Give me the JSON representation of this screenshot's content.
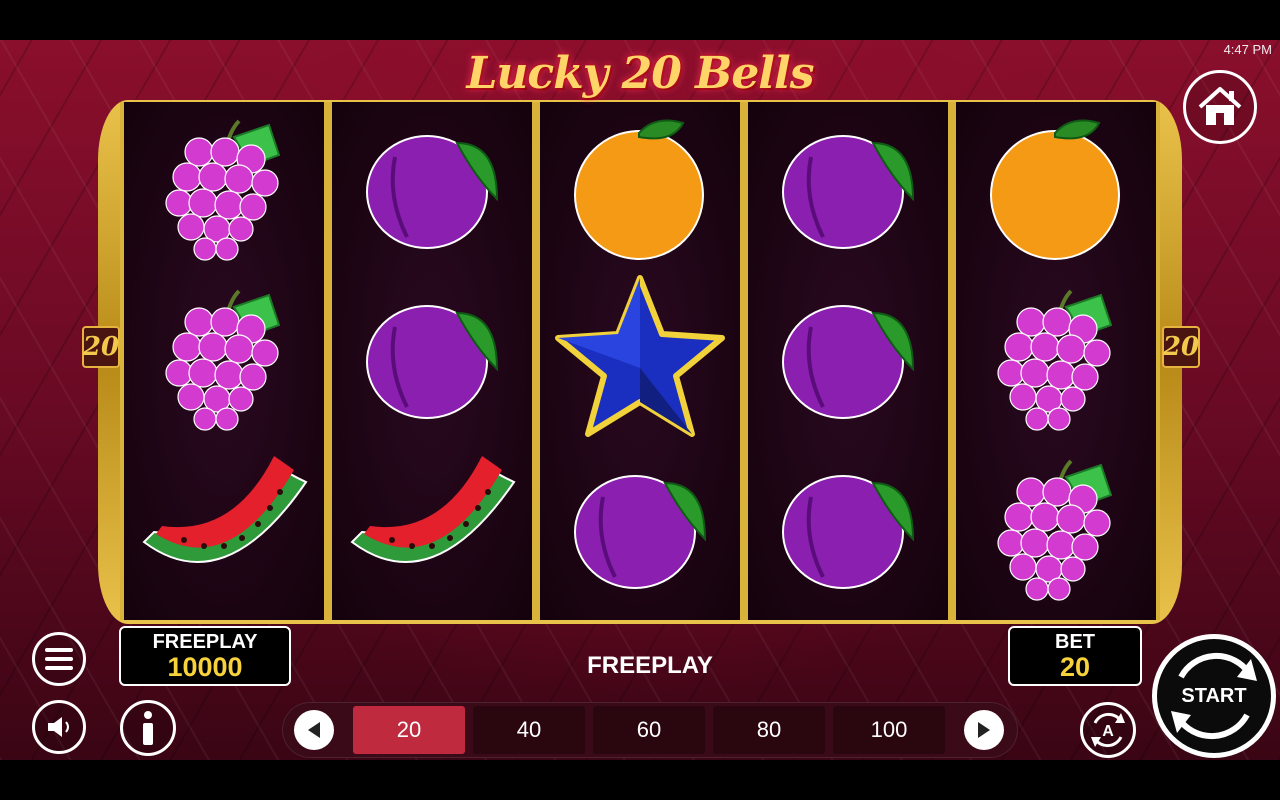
{
  "status_bar": {
    "time": "4:47 PM"
  },
  "game": {
    "title": "Lucky 20 Bells"
  },
  "paylines": {
    "left": "20",
    "right": "20"
  },
  "reels": [
    [
      "grapes",
      "grapes",
      "watermelon"
    ],
    [
      "plum",
      "plum",
      "watermelon"
    ],
    [
      "orange",
      "star",
      "plum"
    ],
    [
      "plum",
      "plum",
      "plum"
    ],
    [
      "orange",
      "grapes",
      "grapes"
    ]
  ],
  "balance": {
    "label": "FREEPLAY",
    "value": "10000"
  },
  "bet": {
    "label": "BET",
    "value": "20"
  },
  "mode_label": "FREEPLAY",
  "bet_selector": {
    "options": [
      "20",
      "40",
      "60",
      "80",
      "100"
    ],
    "selected": "20"
  },
  "controls": {
    "start_label": "START"
  },
  "colors": {
    "accent_gold": "#f7d23b",
    "selected_bet": "#c02a3e",
    "background": "#7a0d28"
  }
}
